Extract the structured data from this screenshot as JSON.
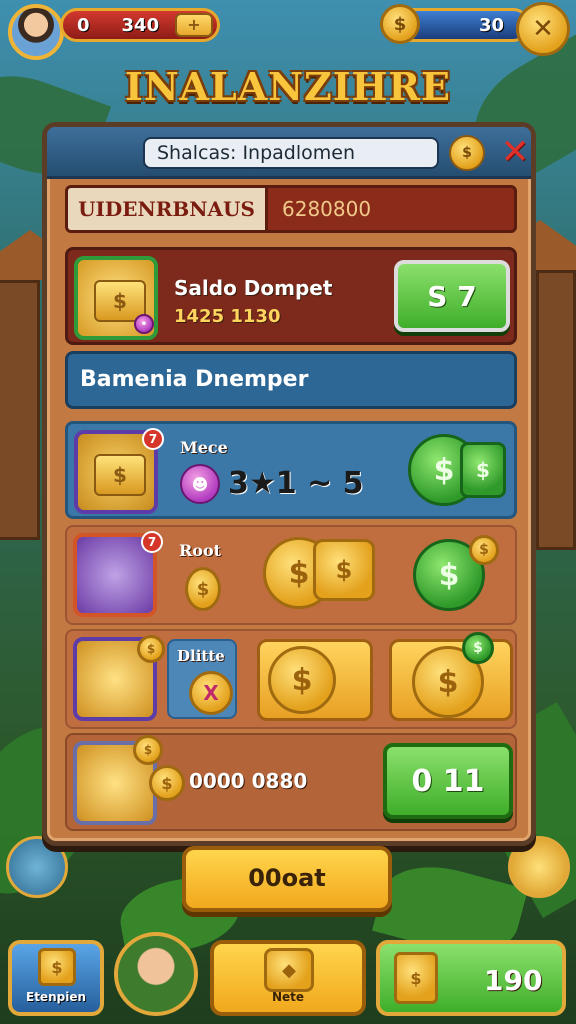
{
  "hud": {
    "health_left": "0",
    "health_value": "340",
    "plus_symbol": "+",
    "gem_value": "30",
    "x_symbol": "✕"
  },
  "title": "INALANZIHRE",
  "panel": {
    "search_text": "Shalcas: Inpadlomen",
    "coin_symbol": "$",
    "close_symbol": "✕",
    "banner_left": "UIDENRBNAUS",
    "banner_right": "6280800",
    "wallet": {
      "title": "Saldo Dompet",
      "amount": "1425 1130",
      "button": "S 7",
      "badge": "$"
    },
    "subheader": "Bamenia Dnemper",
    "rows": [
      {
        "label": "Mece",
        "value": "3★1 ~ 5",
        "badge": "7"
      },
      {
        "label": "Root",
        "badge": "7"
      },
      {
        "label": "Dlitte"
      },
      {
        "amount": "0000 0880",
        "button": "0 11"
      }
    ]
  },
  "main_button": "00oat",
  "nav": {
    "left_label": "Etenpien",
    "center_label": "Nete",
    "right_value": "190"
  },
  "icons": [
    "avatar",
    "coin-icon",
    "close-icon",
    "chest-icon",
    "gift-box-icon",
    "coin-stack-icon",
    "dollar-coin-icon"
  ]
}
